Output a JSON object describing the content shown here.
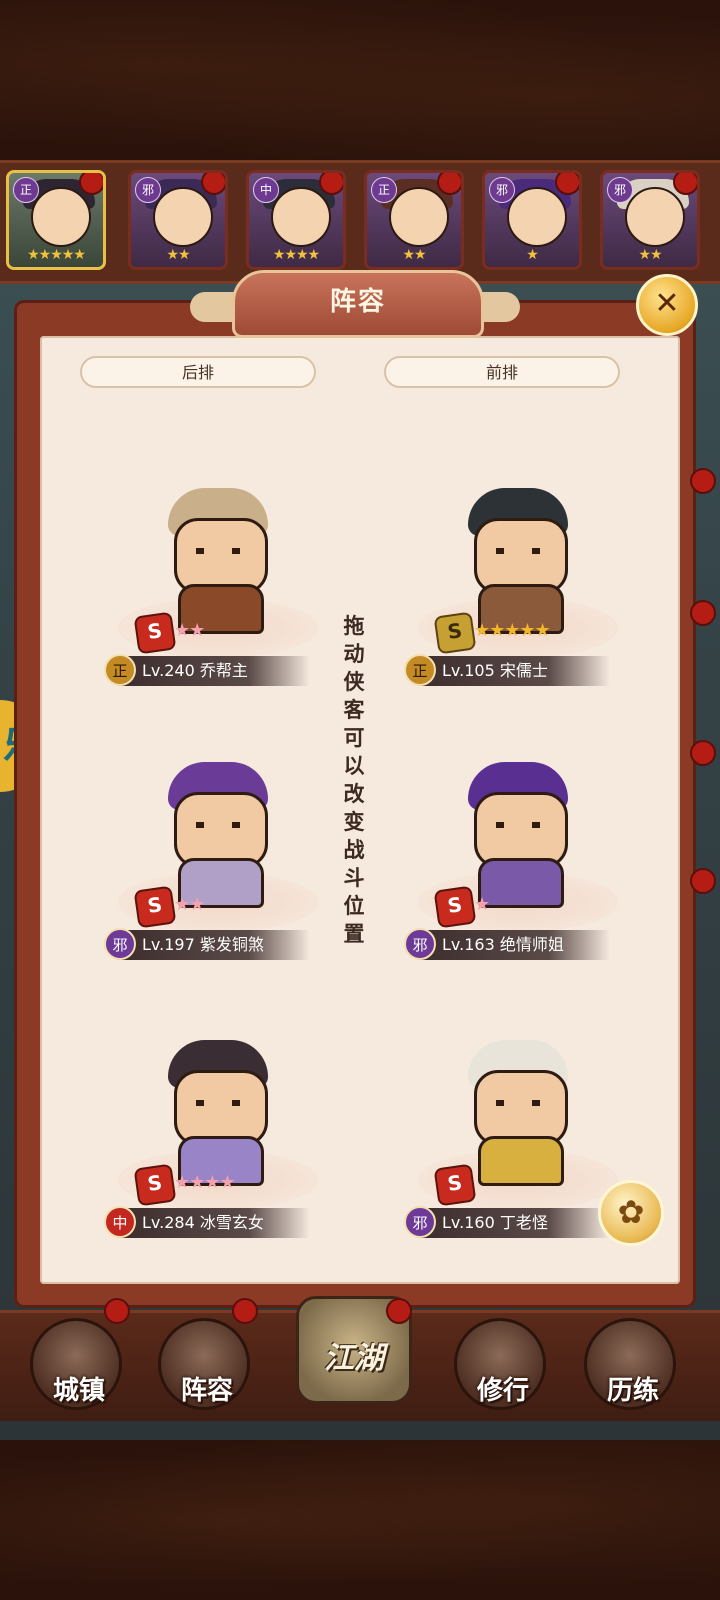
{
  "header": {
    "title": "阵容",
    "close_icon": "close-icon"
  },
  "hero_strip": [
    {
      "faction": "正",
      "stars": "★★★★★",
      "selected": true
    },
    {
      "faction": "邪",
      "stars": "★★",
      "selected": false
    },
    {
      "faction": "中",
      "stars": "★★★★",
      "selected": false
    },
    {
      "faction": "正",
      "stars": "★★",
      "selected": false
    },
    {
      "faction": "邪",
      "stars": "★",
      "selected": false
    },
    {
      "faction": "邪",
      "stars": "★★",
      "selected": false
    }
  ],
  "columns": {
    "back": "后排",
    "front": "前排"
  },
  "hint": "拖动侠客可以改变战斗位置",
  "slots": [
    {
      "faction": "正",
      "level_name": "Lv.240 乔帮主",
      "rank": "S",
      "stars": "★★",
      "star_color": "pink"
    },
    {
      "faction": "正",
      "level_name": "Lv.105 宋儒士",
      "rank": "S",
      "stars": "★★★★★",
      "star_color": "gold"
    },
    {
      "faction": "邪",
      "level_name": "Lv.197 紫发铜煞",
      "rank": "S",
      "stars": "★★",
      "star_color": "pink"
    },
    {
      "faction": "邪",
      "level_name": "Lv.163 绝情师姐",
      "rank": "S",
      "stars": "★",
      "star_color": "pink"
    },
    {
      "faction": "中",
      "level_name": "Lv.284 冰雪玄女",
      "rank": "S",
      "stars": "★★★★",
      "star_color": "pink"
    },
    {
      "faction": "邪",
      "level_name": "Lv.160 丁老怪",
      "rank": "S",
      "stars": "",
      "star_color": "pink"
    }
  ],
  "nav": {
    "town": "城镇",
    "lineup": "阵容",
    "jianghu": "江湖",
    "cultivate": "修行",
    "train": "历练"
  },
  "colors": {
    "panel": "#f6eadf",
    "frame": "#8b3a26",
    "gold": "#e8b32e"
  }
}
